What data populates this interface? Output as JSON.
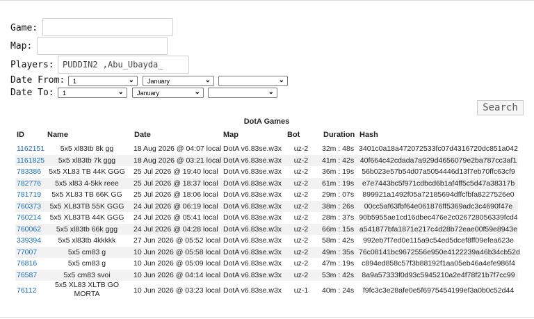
{
  "form": {
    "game_label": "Game:",
    "game_value": "",
    "map_label": "Map:",
    "map_value": "",
    "players_label": "Players:",
    "players_value": "PUDDIN2 ,Abu_Ubayda_",
    "date_from_label": "Date From:",
    "date_to_label": "Date To:",
    "from_day": "1",
    "from_month": "January",
    "from_year": "",
    "to_day": "1",
    "to_month": "January",
    "to_year": "",
    "search_label": "Search"
  },
  "table": {
    "caption": "DotA Games",
    "headers": [
      "ID",
      "Name",
      "Date",
      "Map",
      "Bot",
      "Duration",
      "Hash"
    ],
    "rows": [
      {
        "id": "1162151",
        "name": "5x5 xl83tb 8k gg",
        "date": "18 Aug 2026 @ 04:07 local",
        "map": "DotA v6.83se.w3x",
        "bot": "uz-2",
        "duration": "32m : 48s",
        "hash": "3401c0a18a472072533fc07d4316720dc851a042"
      },
      {
        "id": "1161825",
        "name": "5x5 xl83tb 7k ggg",
        "date": "18 Aug 2026 @ 03:21 local",
        "map": "DotA v6.83se.w3x",
        "bot": "uz-2",
        "duration": "41m : 42s",
        "hash": "40f664c42cdada7a929d4656079e2ba787cc3af1"
      },
      {
        "id": "783386",
        "name": "5x5 XL83 TB 44K GGG",
        "date": "25 Jul 2026 @ 19:40 local",
        "map": "DotA v6.83se.w3x",
        "bot": "uz-2",
        "duration": "36m : 19s",
        "hash": "56b023e57b54d07a5054446d13f7eb70ffc63cf9"
      },
      {
        "id": "782776",
        "name": "5x5 xl83 4-5kk reee",
        "date": "25 Jul 2026 @ 18:37 local",
        "map": "DotA v6.83se.w3x",
        "bot": "uz-2",
        "duration": "61m : 19s",
        "hash": "e7e7443bc5f971cdbcd6b1af4ff5c5d47a38317b"
      },
      {
        "id": "781719",
        "name": "5x5 XL83 TB 66K GG",
        "date": "25 Jul 2026 @ 18:06 local",
        "map": "DotA v6.83se.w3x",
        "bot": "uz-2",
        "duration": "29m : 07s",
        "hash": "899921a1492f05a72185694dffcfbfa8227526e0"
      },
      {
        "id": "760373",
        "name": "5x5 XL83TB 55K GGG",
        "date": "24 Jul 2026 @ 06:19 local",
        "map": "DotA v6.83se.w3x",
        "bot": "uz-2",
        "duration": "38m : 26s",
        "hash": "00cc5af63fbf64e061876ff5369adc3c4690f47e"
      },
      {
        "id": "760214",
        "name": "5x5 XL83TB 44K GGG",
        "date": "24 Jul 2026 @ 05:41 local",
        "map": "DotA v6.83se.w3x",
        "bot": "uz-2",
        "duration": "28m : 37s",
        "hash": "90b5955ae1cd16dbec476e2c026728056339fcd4"
      },
      {
        "id": "760062",
        "name": "5x5 xl83tb 66k ggg",
        "date": "24 Jul 2026 @ 04:28 local",
        "map": "DotA v6.83se.w3x",
        "bot": "uz-2",
        "duration": "66m : 15s",
        "hash": "a541877bfa1871e217c4d28b72eae00f59e8943e"
      },
      {
        "id": "339394",
        "name": "5x5 xl83tb 4kkkkk",
        "date": "27 Jun 2026 @ 05:52 local",
        "map": "DotA v6.83se.w3x",
        "bot": "uz-2",
        "duration": "58m : 42s",
        "hash": "992eb7f7ed0e115a9c54ed5dcef8ff09efea623e"
      },
      {
        "id": "77007",
        "name": "5x5 cm83 g",
        "date": "10 Jun 2026 @ 05:58 local",
        "map": "DotA v6.83se.w3x",
        "bot": "uz-2",
        "duration": "49m : 35s",
        "hash": "76c08141bc9672556e950e4122239a46b34cb52d"
      },
      {
        "id": "76816",
        "name": "5x5 cm83 g",
        "date": "10 Jun 2026 @ 05:09 local",
        "map": "DotA v6.83se.w3x",
        "bot": "uz-2",
        "duration": "47m : 19s",
        "hash": "c894ed858c57f3b88192f1aa05eb46a4efe986f4"
      },
      {
        "id": "76587",
        "name": "5x5 cm83 svoi",
        "date": "10 Jun 2026 @ 04:14 local",
        "map": "DotA v6.83se.w3x",
        "bot": "uz-2",
        "duration": "53m : 42s",
        "hash": "8a9a57333f0d93c5945210a2e4f78f21b7f7cc99"
      },
      {
        "id": "76112",
        "name": "5x5 XL83 XLTB GO MORTA",
        "date": "10 Jun 2026 @ 03:23 local",
        "map": "DotA v6.83se.w3x",
        "bot": "uz-1",
        "duration": "40m : 24s",
        "hash": "f9fc3c3e28afe0e5f6975454199ef3a0b0c52d44"
      }
    ]
  }
}
